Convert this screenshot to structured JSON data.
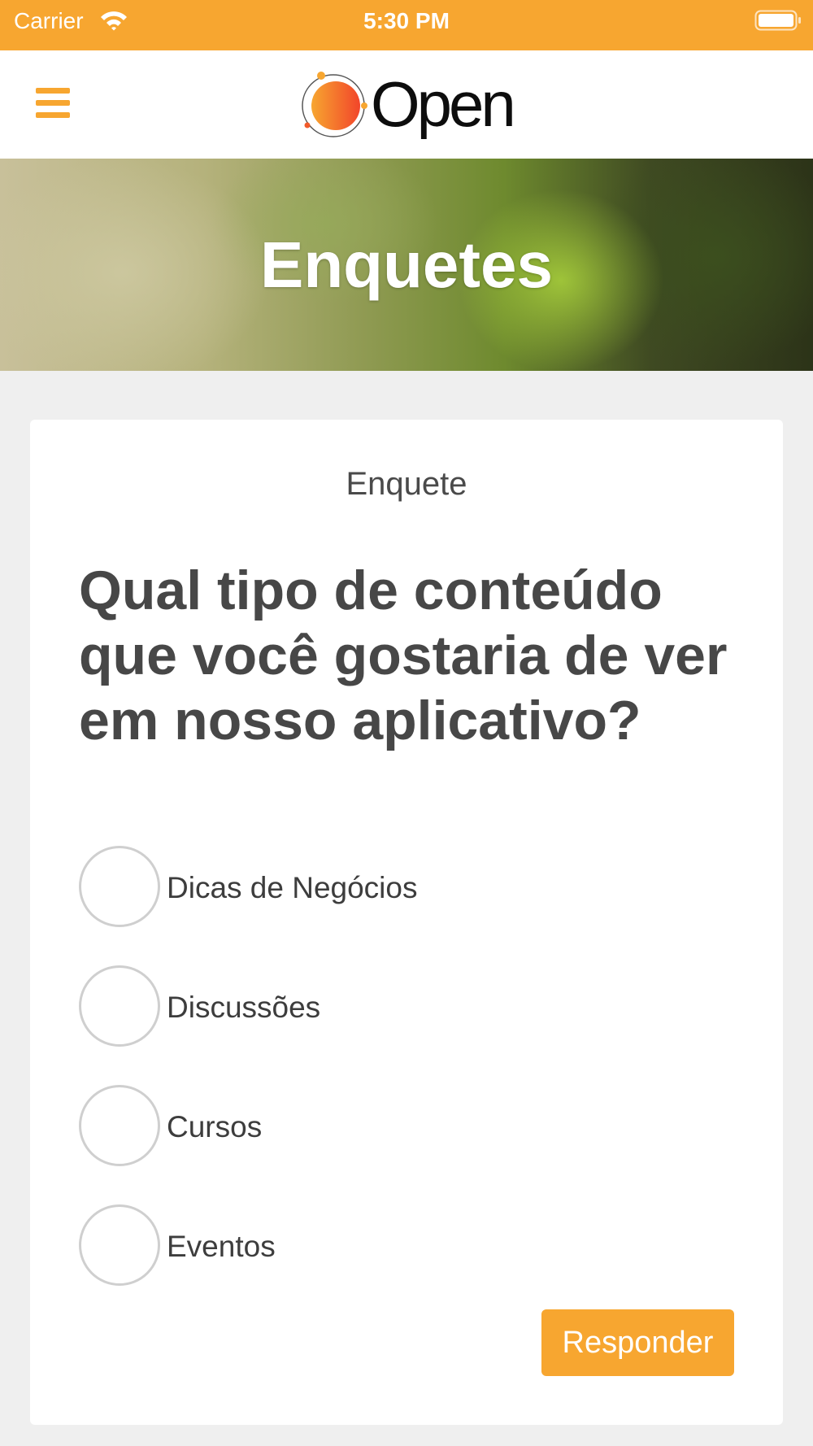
{
  "status_bar": {
    "carrier": "Carrier",
    "time": "5:30 PM"
  },
  "nav": {
    "logo_text": "Open"
  },
  "banner": {
    "title": "Enquetes"
  },
  "poll": {
    "label": "Enquete",
    "question": "Qual tipo de conteúdo que você gostaria de ver em nosso aplicativo?",
    "options": [
      {
        "label": "Dicas de Negócios",
        "selected": false
      },
      {
        "label": "Discussões",
        "selected": false
      },
      {
        "label": "Cursos",
        "selected": false
      },
      {
        "label": "Eventos",
        "selected": false
      }
    ],
    "submit_label": "Responder"
  },
  "colors": {
    "accent": "#f7a630",
    "text_dark": "#474747",
    "background": "#efefef"
  }
}
